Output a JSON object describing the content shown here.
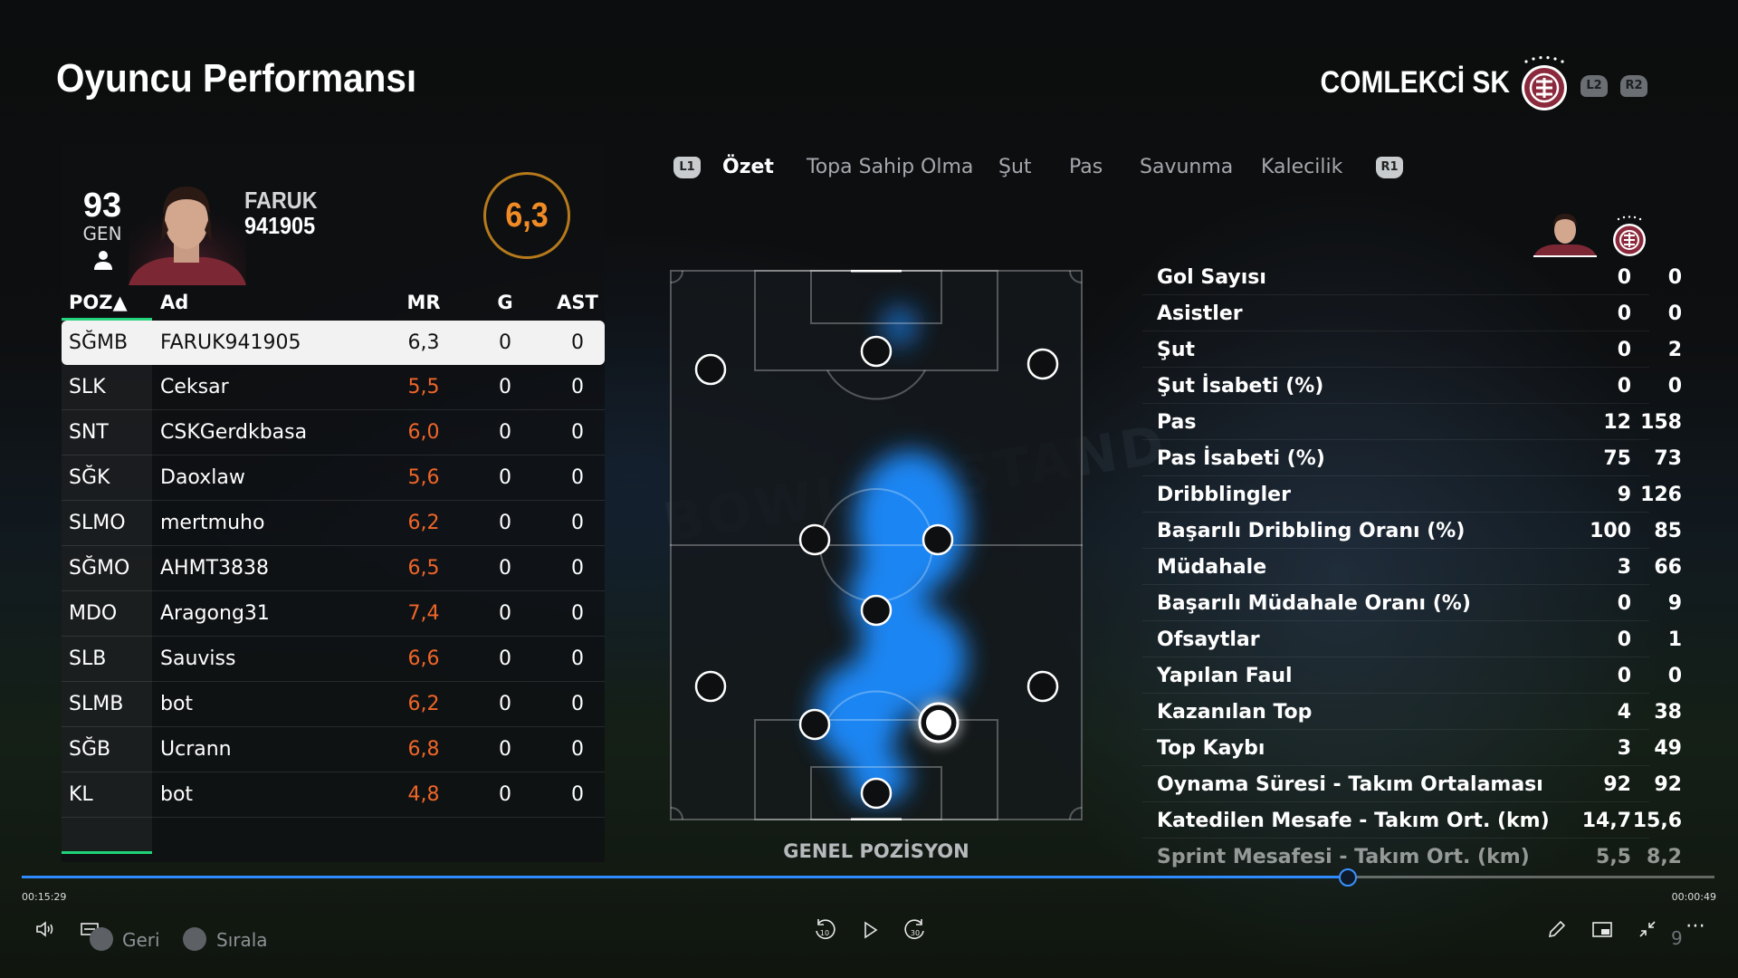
{
  "title": "Oyuncu Performansı",
  "club": {
    "name": "COMLEKCİ SK",
    "l2": "L2",
    "r2": "R2"
  },
  "player": {
    "rank": "93",
    "rank_label": "GEN",
    "name_line1": "FARUK",
    "name_line2": "941905",
    "rating": "6,3"
  },
  "table": {
    "headers": {
      "pos": "POZ▲",
      "name": "Ad",
      "mr": "MR",
      "g": "G",
      "ast": "AST"
    },
    "rows": [
      {
        "pos": "SĞMB",
        "name": "FARUK941905",
        "mr": "6,3",
        "g": "0",
        "ast": "0"
      },
      {
        "pos": "SLK",
        "name": "Ceksar",
        "mr": "5,5",
        "g": "0",
        "ast": "0"
      },
      {
        "pos": "SNT",
        "name": "CSKGerdkbasa",
        "mr": "6,0",
        "g": "0",
        "ast": "0"
      },
      {
        "pos": "SĞK",
        "name": "Daoxlaw",
        "mr": "5,6",
        "g": "0",
        "ast": "0"
      },
      {
        "pos": "SLMO",
        "name": "mertmuho",
        "mr": "6,2",
        "g": "0",
        "ast": "0"
      },
      {
        "pos": "SĞMO",
        "name": "AHMT3838",
        "mr": "6,5",
        "g": "0",
        "ast": "0"
      },
      {
        "pos": "MDO",
        "name": "Aragong31",
        "mr": "7,4",
        "g": "0",
        "ast": "0"
      },
      {
        "pos": "SLB",
        "name": "Sauviss",
        "mr": "6,6",
        "g": "0",
        "ast": "0"
      },
      {
        "pos": "SLMB",
        "name": "bot",
        "mr": "6,2",
        "g": "0",
        "ast": "0"
      },
      {
        "pos": "SĞB",
        "name": "Ucrann",
        "mr": "6,8",
        "g": "0",
        "ast": "0"
      },
      {
        "pos": "KL",
        "name": "bot",
        "mr": "4,8",
        "g": "0",
        "ast": "0"
      }
    ]
  },
  "tabs": {
    "l1": "L1",
    "r1": "R1",
    "items": [
      "Özet",
      "Topa Sahip Olma",
      "Şut",
      "Pas",
      "Savunma",
      "Kalecilik"
    ],
    "active": "Özet"
  },
  "pitch_label": "GENEL POZİSYON",
  "stats": [
    {
      "label": "Gol Sayısı",
      "player": "0",
      "team": "0"
    },
    {
      "label": "Asistler",
      "player": "0",
      "team": "0"
    },
    {
      "label": "Şut",
      "player": "0",
      "team": "2"
    },
    {
      "label": "Şut İsabeti (%)",
      "player": "0",
      "team": "0"
    },
    {
      "label": "Pas",
      "player": "12",
      "team": "158"
    },
    {
      "label": "Pas İsabeti (%)",
      "player": "75",
      "team": "73"
    },
    {
      "label": "Dribblingler",
      "player": "9",
      "team": "126"
    },
    {
      "label": "Başarılı Dribbling Oranı (%)",
      "player": "100",
      "team": "85"
    },
    {
      "label": "Müdahale",
      "player": "3",
      "team": "66"
    },
    {
      "label": "Başarılı Müdahale Oranı (%)",
      "player": "0",
      "team": "9"
    },
    {
      "label": "Ofsaytlar",
      "player": "0",
      "team": "1"
    },
    {
      "label": "Yapılan Faul",
      "player": "0",
      "team": "0"
    },
    {
      "label": "Kazanılan Top",
      "player": "4",
      "team": "38"
    },
    {
      "label": "Top Kaybı",
      "player": "3",
      "team": "49"
    },
    {
      "label": "Oynama Süresi - Takım Ortalaması",
      "player": "92",
      "team": "92"
    },
    {
      "label": "Katedilen Mesafe - Takım Ort. (km)",
      "player": "14,7",
      "team": "15,6"
    },
    {
      "label": "Sprint Mesafesi - Takım Ort. (km)",
      "player": "5,5",
      "team": "8,2"
    }
  ],
  "playback": {
    "time_elapsed": "00:15:29",
    "time_remaining": "00:00:49",
    "progress": 0.783,
    "back_label": "Geri",
    "sort_label": "Sırala",
    "rewind_label": "10",
    "forward_label": "30",
    "count": "9"
  },
  "colors": {
    "accent_green": "#1fd27a",
    "rating_orange": "#f08b26",
    "heat_blue": "#1a8cff",
    "club_maroon": "#8b2a3c"
  }
}
